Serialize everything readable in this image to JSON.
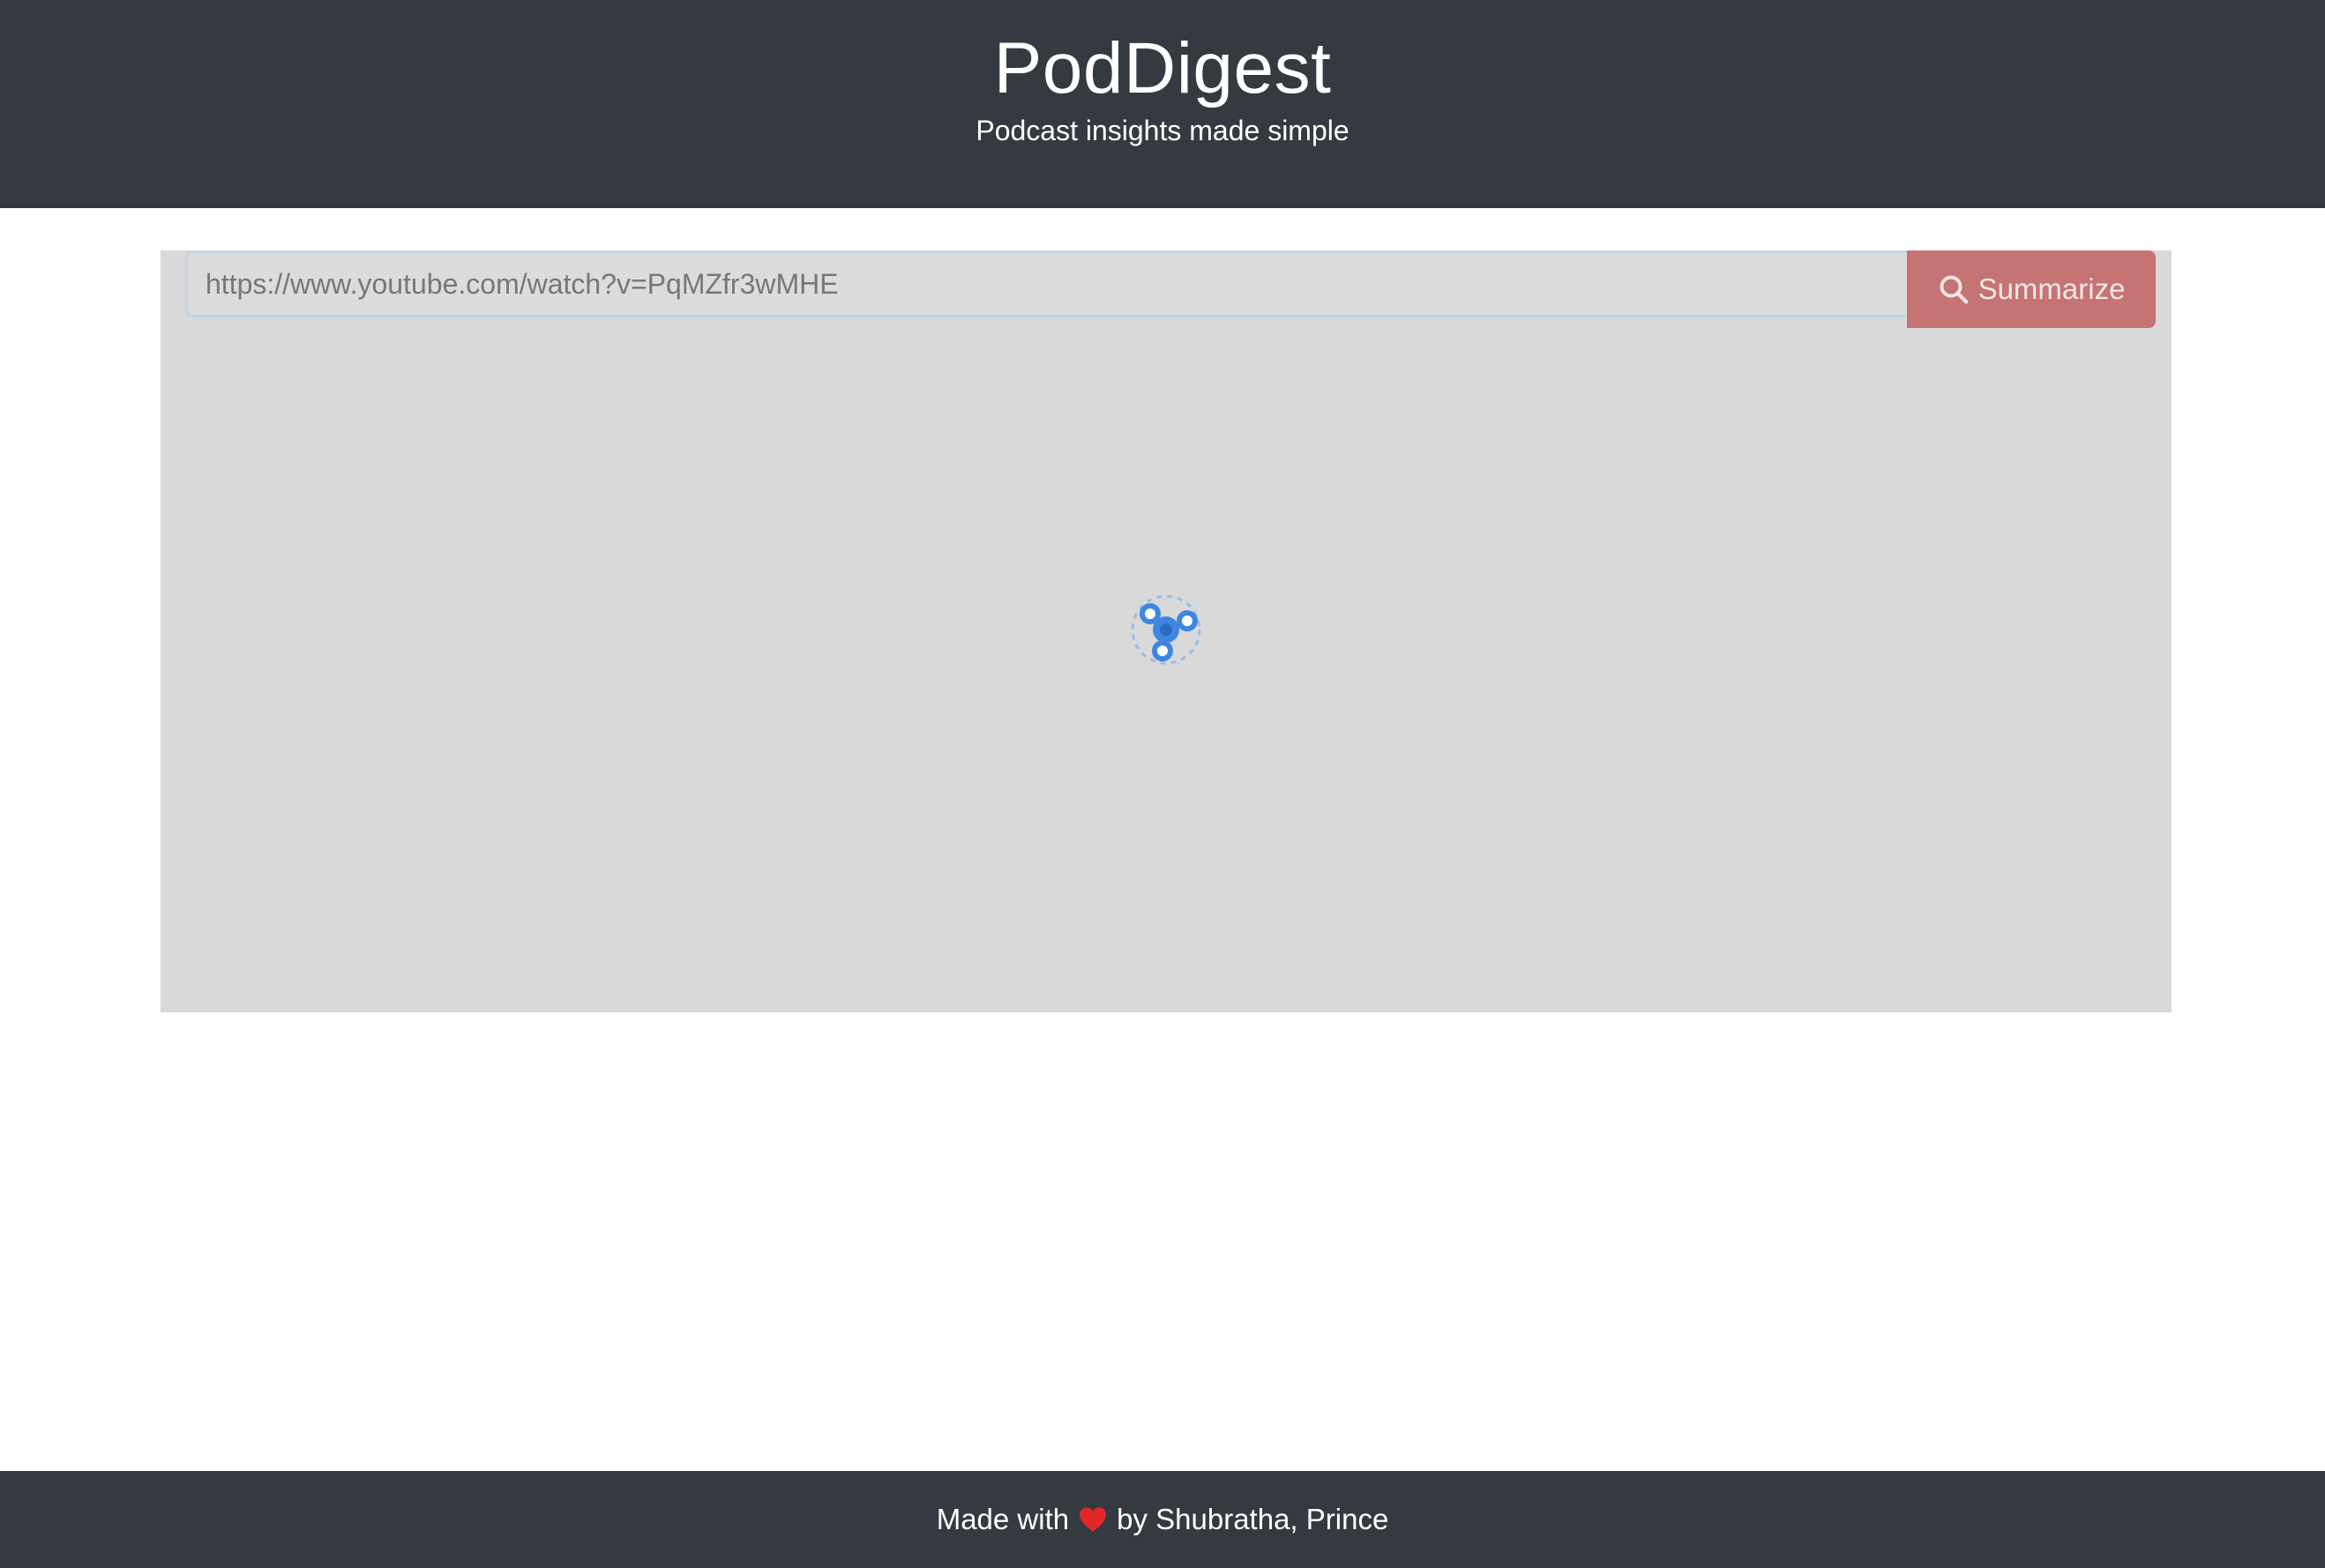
{
  "header": {
    "title": "PodDigest",
    "subtitle": "Podcast insights made simple"
  },
  "search": {
    "placeholder": "https://www.youtube.com/watch?v=PqMZfr3wMHE",
    "value": "",
    "button_label": "Summarize",
    "button_icon": "search-icon"
  },
  "main": {
    "loading_icon": "fidget-spinner-icon"
  },
  "footer": {
    "prefix": "Made with",
    "icon": "heart-icon",
    "suffix": "by Shubratha, Prince"
  },
  "colors": {
    "header_bg": "#343a40",
    "panel_bg": "#d9d9d9",
    "button_bg": "#c57373",
    "spinner": "#3f86e0",
    "heart": "#e0282b"
  }
}
